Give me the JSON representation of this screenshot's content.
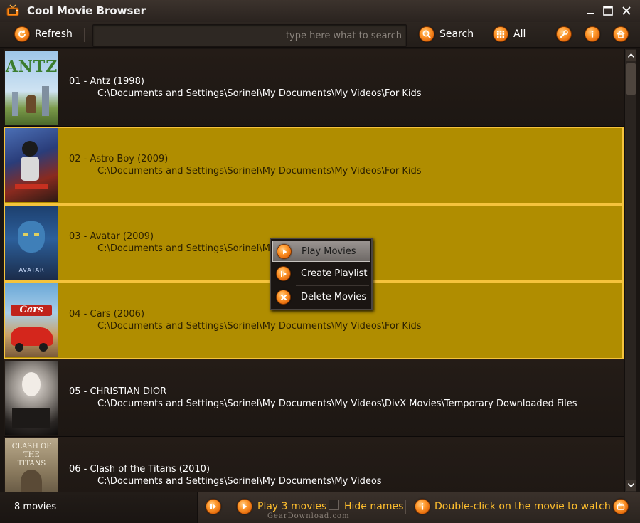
{
  "window": {
    "title": "Cool Movie Browser"
  },
  "toolbar": {
    "refresh_label": "Refresh",
    "search_placeholder": "type here what to search",
    "search_label": "Search",
    "all_label": "All"
  },
  "movies": [
    {
      "title": "01 - Antz (1998)",
      "path": "C:\\Documents and Settings\\Sorinel\\My Documents\\My Videos\\For Kids",
      "poster_text": "ANTZ",
      "selected": false
    },
    {
      "title": "02 - Astro Boy (2009)",
      "path": "C:\\Documents and Settings\\Sorinel\\My Documents\\My Videos\\For Kids",
      "poster_text": "",
      "selected": true
    },
    {
      "title": "03 - Avatar (2009)",
      "path": "C:\\Documents and Settings\\Sorinel\\My",
      "poster_text": "AVATAR",
      "selected": true
    },
    {
      "title": "04 - Cars (2006)",
      "path": "C:\\Documents and Settings\\Sorinel\\My Documents\\My Videos\\For Kids",
      "poster_text": "Cars",
      "selected": true
    },
    {
      "title": "05 - CHRISTIAN DIOR",
      "path": "C:\\Documents and Settings\\Sorinel\\My Documents\\My Videos\\DivX Movies\\Temporary Downloaded Files",
      "poster_text": "",
      "selected": false
    },
    {
      "title": "06 - Clash of the Titans (2010)",
      "path": "C:\\Documents and Settings\\Sorinel\\My Documents\\My Videos",
      "poster_text": "CLASH OF THE TITANS",
      "selected": false
    }
  ],
  "context_menu": {
    "items": [
      "Play Movies",
      "Create Playlist",
      "Delete Movies"
    ]
  },
  "status": {
    "count": "8 movies",
    "play_label": "Play 3 movies",
    "hide_names_label": "Hide names",
    "hint": "Double-click on the movie to watch it !",
    "watermark": "GearDownload.com"
  },
  "colors": {
    "accent": "#ff9a2e",
    "selection": "#b08d00",
    "selection_border": "#f5c33c",
    "status_text": "#ffbf2e"
  }
}
